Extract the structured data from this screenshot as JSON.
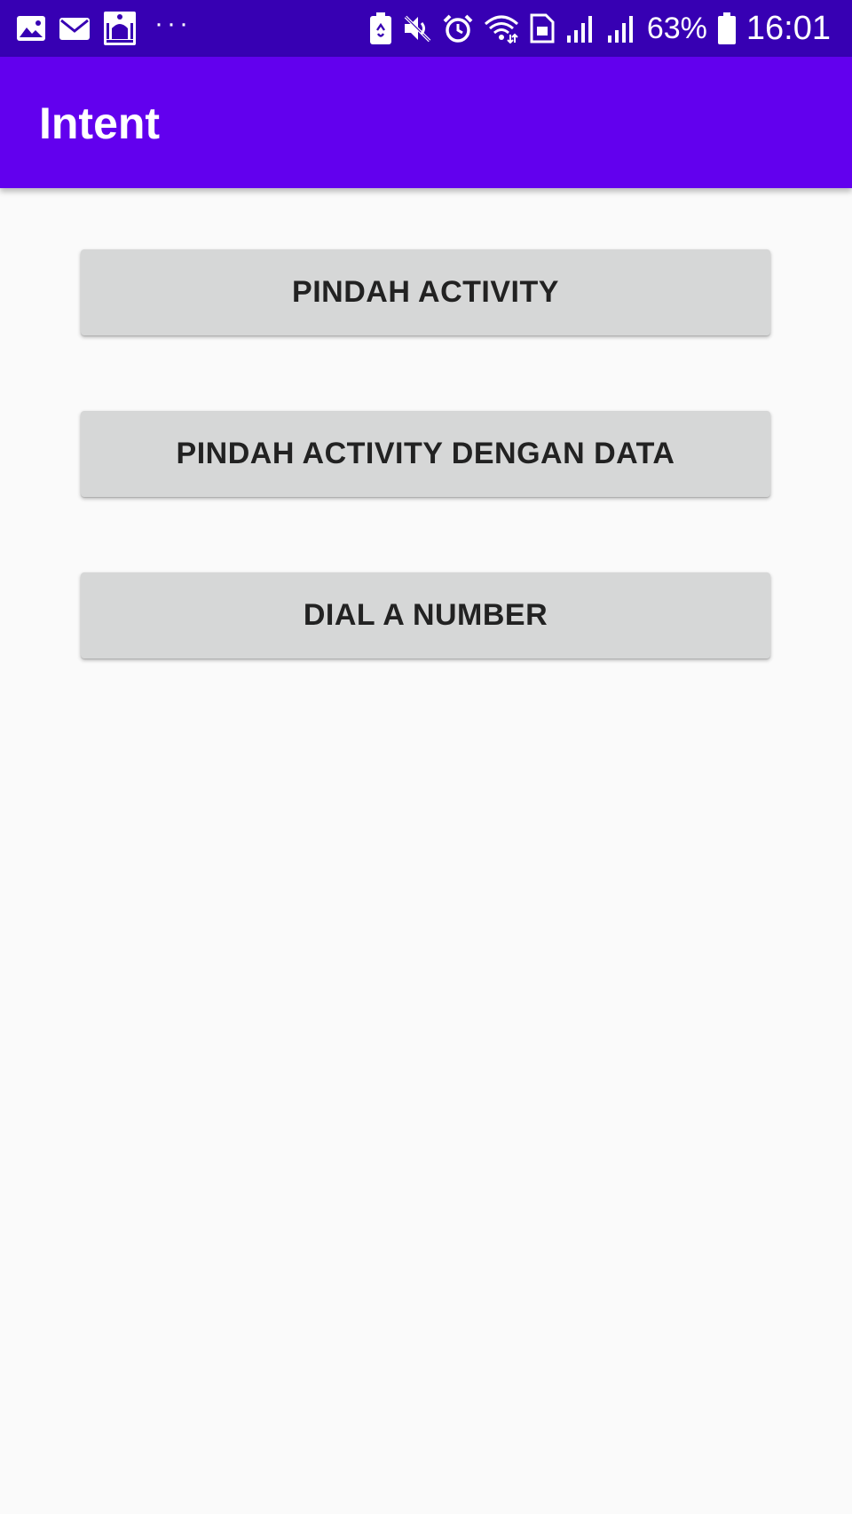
{
  "status_bar": {
    "left_icons": [
      "image-icon",
      "mail-icon",
      "mosque-icon"
    ],
    "more": "···",
    "battery_percent": "63%",
    "time": "16:01",
    "background": "#3700b3"
  },
  "app_bar": {
    "title": "Intent",
    "background": "#6200ee"
  },
  "buttons": [
    {
      "label": "PINDAH ACTIVITY"
    },
    {
      "label": "PINDAH ACTIVITY DENGAN DATA"
    },
    {
      "label": "DIAL A NUMBER"
    }
  ],
  "colors": {
    "button_bg": "#d6d7d7",
    "button_text": "#222222",
    "page_bg": "#fafafa"
  }
}
